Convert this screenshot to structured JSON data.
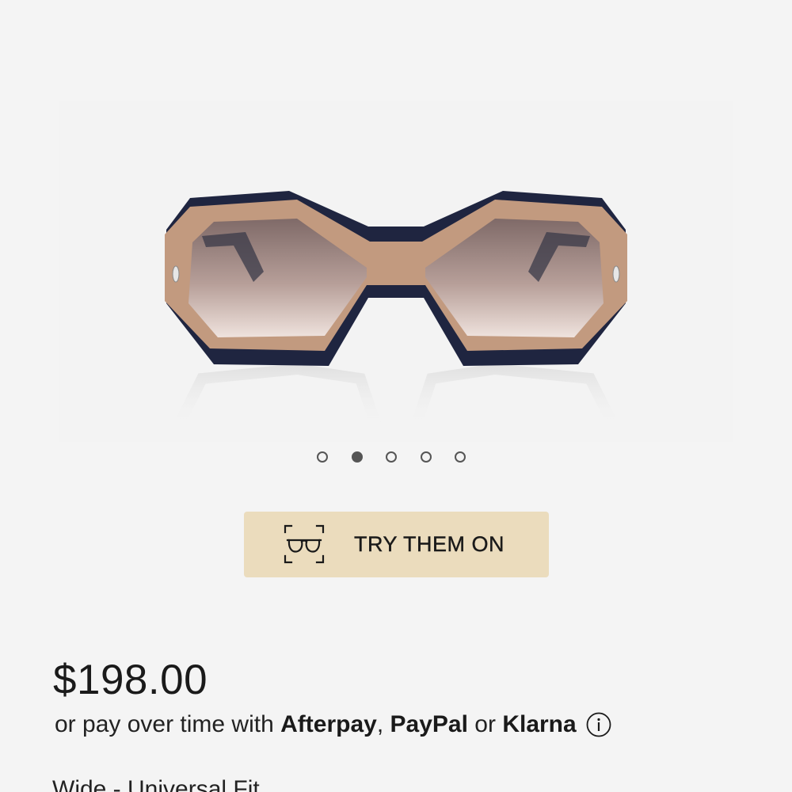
{
  "gallery": {
    "image_alt": "Tortoise-tan oversized geometric sunglasses, front view",
    "dots_count": 5,
    "active_dot_index": 1
  },
  "try_on": {
    "label": "TRY THEM ON",
    "icon": "virtual-try-on-icon"
  },
  "pricing": {
    "price": "$198.00",
    "pay_prefix": "or pay over time with",
    "provider_1": "Afterpay",
    "separator_1": ",",
    "provider_2": "PayPal",
    "connector": "or",
    "provider_3": "Klarna",
    "info_icon": "info-icon"
  },
  "fit": {
    "text": "Wide - Universal Fit"
  },
  "colors": {
    "background": "#f4f4f4",
    "try_on_bg": "#ebdcbd",
    "frame_tan": "#c29a7f",
    "frame_navy": "#1f2540",
    "lens_top": "#8a7370",
    "lens_bottom": "#e8d9d4"
  }
}
